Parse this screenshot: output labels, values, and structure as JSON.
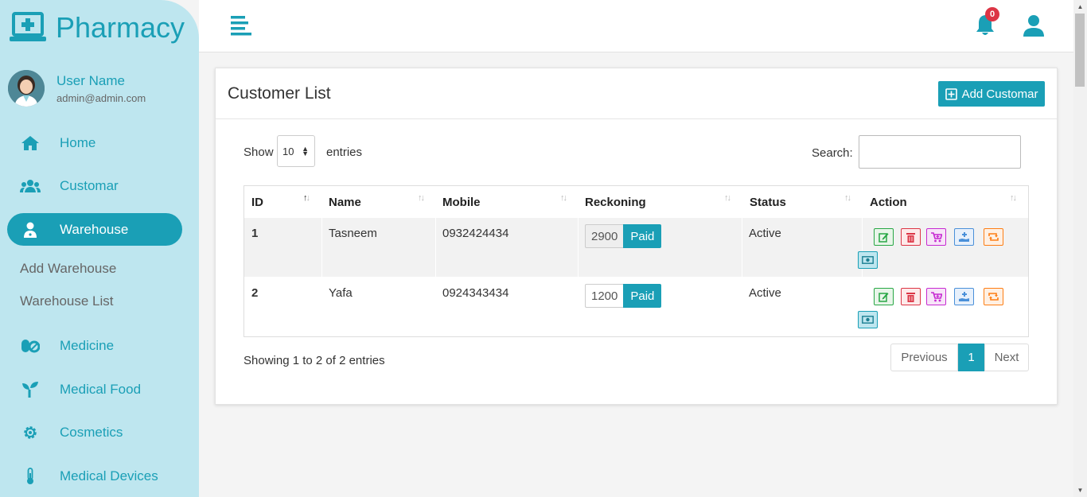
{
  "brand": {
    "title": "Pharmacy"
  },
  "user": {
    "name": "User Name",
    "email": "admin@admin.com"
  },
  "sidebar": {
    "items": [
      {
        "label": "Home",
        "icon": "home-icon"
      },
      {
        "label": "Customar",
        "icon": "users-icon"
      },
      {
        "label": "Warehouse",
        "icon": "user-md-icon",
        "active": true
      },
      {
        "label": "Medicine",
        "icon": "pills-icon"
      },
      {
        "label": "Medical Food",
        "icon": "seedling-icon"
      },
      {
        "label": "Cosmetics",
        "icon": "gear-icon"
      },
      {
        "label": "Medical Devices",
        "icon": "thermometer-icon"
      }
    ],
    "subitems": [
      {
        "label": "Add Warehouse"
      },
      {
        "label": "Warehouse List"
      }
    ]
  },
  "topbar": {
    "notification_count": "0"
  },
  "card": {
    "title": "Customer List",
    "add_button": "Add Customar",
    "show_label": "Show",
    "entries_value": "10",
    "entries_label": "entries",
    "search_label": "Search:",
    "search_value": ""
  },
  "table": {
    "columns": [
      "ID",
      "Name",
      "Mobile",
      "Reckoning",
      "Status",
      "Action"
    ],
    "rows": [
      {
        "id": "1",
        "name": "Tasneem",
        "mobile": "0932424434",
        "amount": "2900",
        "paid": "Paid",
        "status": "Active"
      },
      {
        "id": "2",
        "name": "Yafa",
        "mobile": "0924343434",
        "amount": "1200",
        "paid": "Paid",
        "status": "Active"
      }
    ]
  },
  "footer": {
    "showing": "Showing 1 to 2 of 2 entries"
  },
  "pagination": {
    "previous": "Previous",
    "current": "1",
    "next": "Next"
  },
  "colors": {
    "accent": "#1a9fb6",
    "sidebar_bg": "#bee6ef",
    "badge": "#dc3545"
  }
}
